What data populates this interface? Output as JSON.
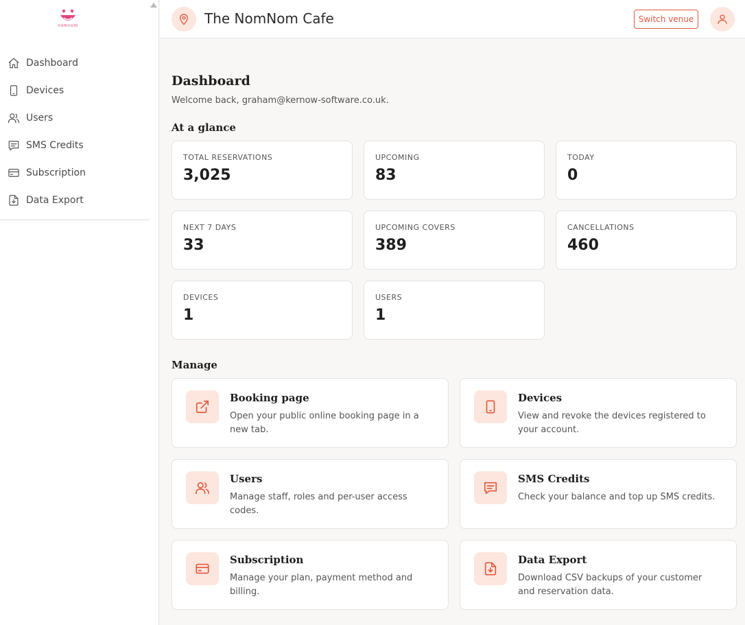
{
  "brand": {
    "logo_text": "nomnom",
    "accent": "#e2583e",
    "accent_soft": "#fde6de",
    "logo_color": "#e0457b"
  },
  "sidebar": {
    "items": [
      {
        "label": "Dashboard",
        "icon": "home-icon"
      },
      {
        "label": "Devices",
        "icon": "phone-icon"
      },
      {
        "label": "Users",
        "icon": "users-icon"
      },
      {
        "label": "SMS Credits",
        "icon": "message-icon"
      },
      {
        "label": "Subscription",
        "icon": "credit-card-icon"
      },
      {
        "label": "Data Export",
        "icon": "file-download-icon"
      }
    ]
  },
  "header": {
    "venue_name": "The NomNom Cafe",
    "switch_label": "Switch venue",
    "venue_icon": "location-pin-icon",
    "user_icon": "user-icon"
  },
  "main": {
    "title": "Dashboard",
    "welcome": "Welcome back, graham@kernow-software.co.uk.",
    "glance_title": "At a glance",
    "stats": [
      {
        "label": "Total reservations",
        "value": "3,025"
      },
      {
        "label": "Upcoming",
        "value": "83"
      },
      {
        "label": "Today",
        "value": "0"
      },
      {
        "label": "Next 7 days",
        "value": "33"
      },
      {
        "label": "Upcoming covers",
        "value": "389"
      },
      {
        "label": "Cancellations",
        "value": "460"
      },
      {
        "label": "Devices",
        "value": "1"
      },
      {
        "label": "Users",
        "value": "1"
      }
    ],
    "manage_title": "Manage",
    "cards": [
      {
        "title": "Booking page",
        "desc": "Open your public online booking page in a new tab.",
        "icon": "external-link-icon"
      },
      {
        "title": "Devices",
        "desc": "View and revoke the devices registered to your account.",
        "icon": "phone-icon"
      },
      {
        "title": "Users",
        "desc": "Manage staff, roles and per-user access codes.",
        "icon": "users-icon"
      },
      {
        "title": "SMS Credits",
        "desc": "Check your balance and top up SMS credits.",
        "icon": "message-icon"
      },
      {
        "title": "Subscription",
        "desc": "Manage your plan, payment method and billing.",
        "icon": "credit-card-icon"
      },
      {
        "title": "Data Export",
        "desc": "Download CSV backups of your customer and reservation data.",
        "icon": "file-download-icon"
      }
    ]
  }
}
